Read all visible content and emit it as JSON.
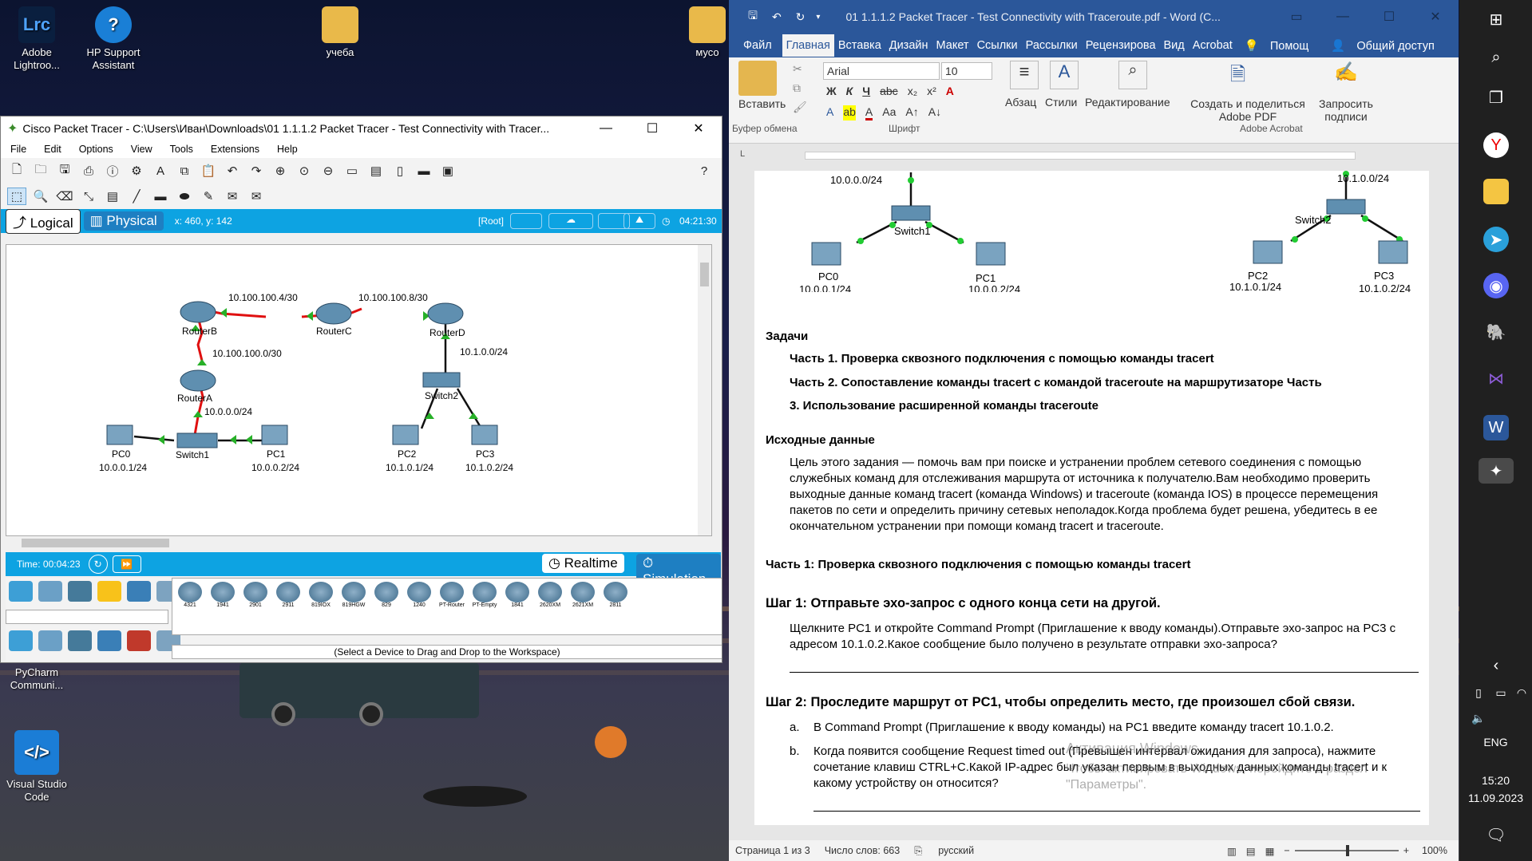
{
  "desktop": {
    "icons": [
      {
        "label": "Adobe Lightroo...",
        "glyph": "Lrc",
        "color": "#0a1f3f",
        "fg": "#4ea3ff"
      },
      {
        "label": "HP Support Assistant",
        "glyph": "?",
        "color": "#1a7fd6",
        "fg": "#ffffff"
      },
      {
        "label": "учеба",
        "glyph": "",
        "color": "#e9b94a",
        "fg": "#000"
      },
      {
        "label": "мусо",
        "glyph": "",
        "color": "#e9b94a",
        "fg": "#000"
      },
      {
        "label": "PyCharm Communi...",
        "glyph": "PC",
        "color": "#111",
        "fg": "#2fe37a"
      },
      {
        "label": "Visual Studio Code",
        "glyph": "</>",
        "color": "#1b7dd6",
        "fg": "#fff"
      }
    ]
  },
  "pt": {
    "title": "Cisco Packet Tracer - C:\\Users\\Иван\\Downloads\\01 1.1.1.2 Packet Tracer - Test Connectivity with Tracer...",
    "menu": [
      "File",
      "Edit",
      "Options",
      "View",
      "Tools",
      "Extensions",
      "Help"
    ],
    "logical_tab": "Logical",
    "physical_tab": "Physical",
    "coords": "x: 460, y: 142",
    "root": "[Root]",
    "clock": "04:21:30",
    "time": "Time: 00:04:23",
    "realtime": "Realtime",
    "simulation": "Simulation",
    "hint": "(Select a Device to Drag and Drop to the Workspace)",
    "models": [
      "4321",
      "1941",
      "2901",
      "2911",
      "819IOX",
      "819HGW",
      "829",
      "1240",
      "PT-Router",
      "PT-Empty",
      "1841",
      "2620XM",
      "2621XM",
      "2811"
    ],
    "topology": {
      "labels": [
        {
          "t": "10.100.100.4/30"
        },
        {
          "t": "10.100.100.8/30"
        },
        {
          "t": "RouterB"
        },
        {
          "t": "RouterC"
        },
        {
          "t": "RouterD"
        },
        {
          "t": "10.100.100.0/30"
        },
        {
          "t": "10.1.0.0/24"
        },
        {
          "t": "RouterA"
        },
        {
          "t": "Switch2"
        },
        {
          "t": "10.0.0.0/24"
        },
        {
          "t": "Switch1"
        },
        {
          "t": "PC0"
        },
        {
          "t": "PC1"
        },
        {
          "t": "PC2"
        },
        {
          "t": "PC3"
        },
        {
          "t": "10.0.0.1/24"
        },
        {
          "t": "10.0.0.2/24"
        },
        {
          "t": "10.1.0.1/24"
        },
        {
          "t": "10.1.0.2/24"
        }
      ]
    }
  },
  "word": {
    "title": "01 1.1.1.2 Packet Tracer - Test Connectivity with Traceroute.pdf  -  Word (С...",
    "tabs": [
      "Файл",
      "Главная",
      "Вставка",
      "Дизайн",
      "Макет",
      "Ссылки",
      "Рассылки",
      "Рецензирова",
      "Вид",
      "Acrobat",
      "Помощ",
      "Общий доступ"
    ],
    "ribbon": {
      "paste": "Вставить",
      "font": "Arial",
      "size": "10",
      "paragraph": "Абзац",
      "styles": "Стили",
      "editing": "Редактирование",
      "share": "Создать и поделиться Adobe PDF",
      "sign": "Запросить подписи",
      "g_clip": "Буфер обмена",
      "g_font": "Шрифт",
      "g_acro": "Adobe Acrobat"
    },
    "diagram": [
      "10.0.0.0/24",
      "Switch1",
      "PC0",
      "10.0.0.1/24",
      "PC1",
      "10.0.0.2/24",
      "10.1.0.0/24",
      "Switch2",
      "PC2",
      "10.1.0.1/24",
      "PC3",
      "10.1.0.2/24"
    ],
    "tasks_h": "Задачи",
    "task1": "Часть 1. Проверка сквозного подключения с помощью команды tracert",
    "task2": "Часть 2. Сопоставление команды tracert с командой traceroute на маршрутизаторе Часть",
    "task3": "3. Использование расширенной команды traceroute",
    "src_h": "Исходные данные",
    "src_p": "Цель этого задания — помочь вам при поиске и устранении проблем сетевого соединения с помощью служебных команд для отслеживания маршрута от источника к получателю.Вам необходимо проверить выходные данные команд tracert (команда Windows) и traceroute (команда IOS) в процессе перемещения пакетов по сети и определить причину сетевых неполадок.Когда проблема будет решена, убедитесь в ее окончательном устранении при помощи команд tracert и traceroute.",
    "part1": "Часть 1: Проверка сквозного подключения с помощью команды tracert",
    "step1": "Шаг 1:    Отправьте эхо-запрос с одного конца сети на другой.",
    "step1_p": "Щелкните PC1 и откройте Command Prompt (Приглашение к вводу команды).Отправьте эхо-запрос на PC3 с адресом 10.1.0.2.Какое сообщение было получено в результате отправки эхо-запроса?",
    "step2": "Шаг 2:    Проследите маршрут от PC1, чтобы определить место, где произошел сбой связи.",
    "a_m": "a.",
    "a": "В Command Prompt (Приглашение к вводу команды) на PC1 введите команду tracert 10.1.0.2.",
    "b_m": "b.",
    "b": "Когда появится сообщение Request timed out (Превышен интервал ожидания для запроса), нажмите сочетание клавиш CTRL+C.Какой IP-адрес был указан первым в выходных данных команды tracert и к какому устройству он относится?",
    "watermark1": "Активация Windows",
    "watermark2": "Чтобы активировать Windows, перейдите в раздел \"Параметры\".",
    "status_page": "Страница 1 из 3",
    "status_words": "Число слов: 663",
    "status_lang": "русский",
    "zoom": "100%"
  },
  "taskbar": {
    "lang": "ENG",
    "time": "15:20",
    "date": "11.09.2023"
  }
}
